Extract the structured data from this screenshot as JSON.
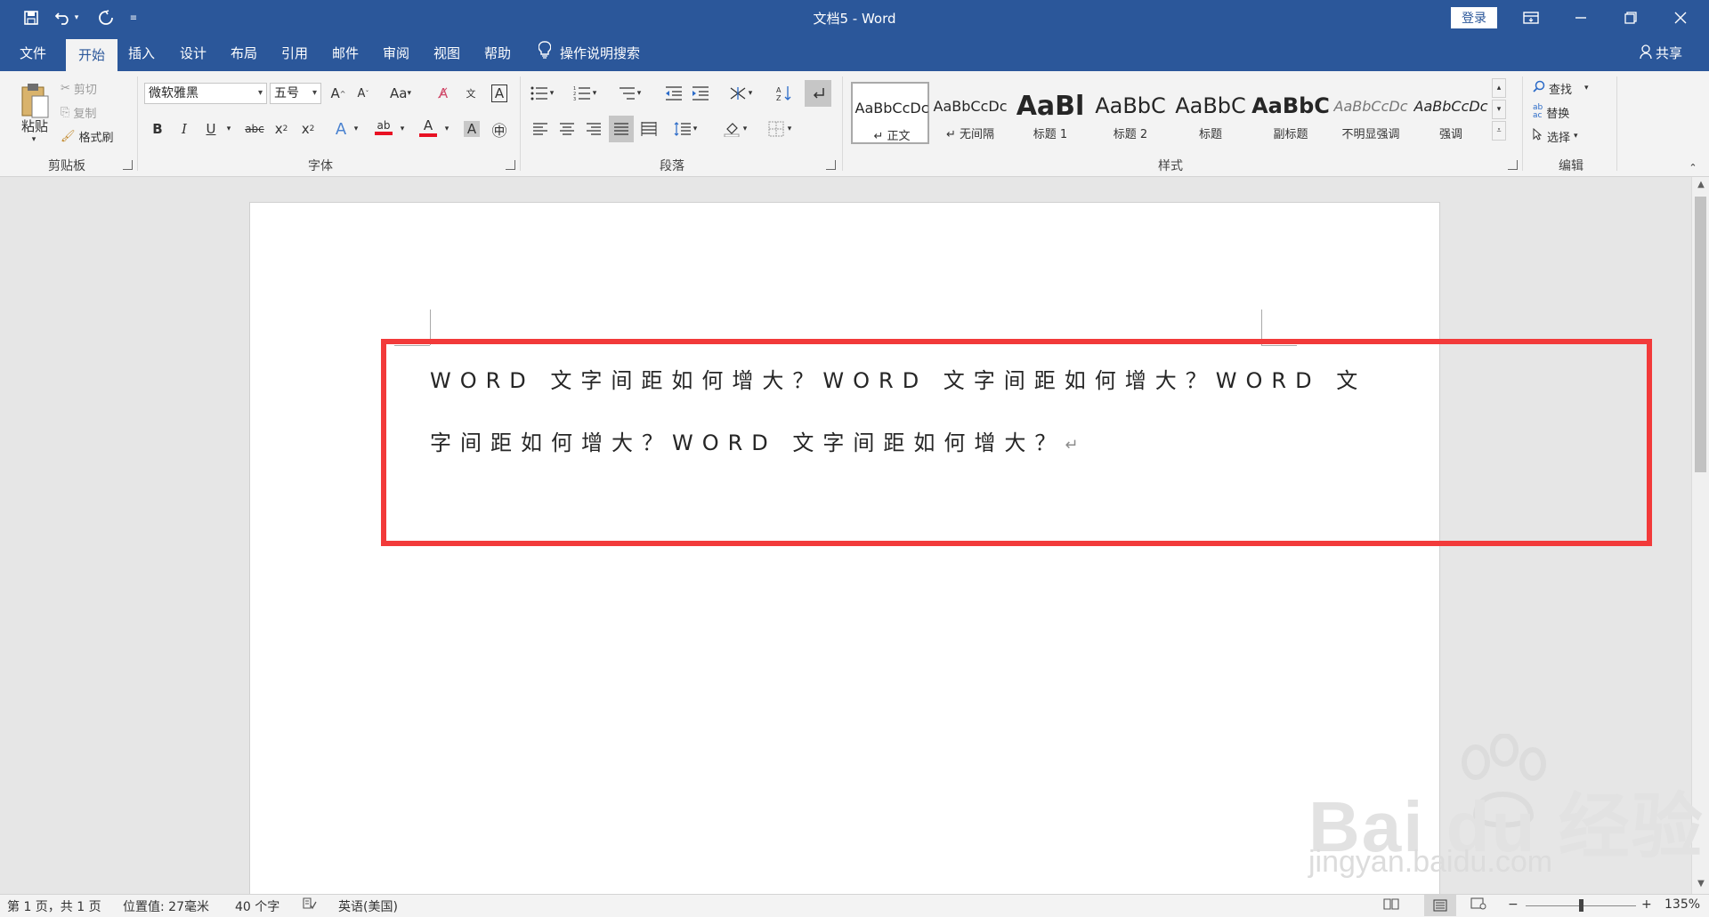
{
  "window": {
    "title": "文档5  -  Word",
    "login_label": "登录"
  },
  "tabs": [
    {
      "label": "文件"
    },
    {
      "label": "开始"
    },
    {
      "label": "插入"
    },
    {
      "label": "设计"
    },
    {
      "label": "布局"
    },
    {
      "label": "引用"
    },
    {
      "label": "邮件"
    },
    {
      "label": "审阅"
    },
    {
      "label": "视图"
    },
    {
      "label": "帮助"
    }
  ],
  "active_tab": "开始",
  "tell_me": "操作说明搜索",
  "share_label": "共享",
  "clipboard": {
    "paste": "粘贴",
    "cut": "剪切",
    "copy": "复制",
    "format_painter": "格式刷",
    "label": "剪贴板"
  },
  "font": {
    "name": "微软雅黑",
    "size": "五号",
    "label": "字体"
  },
  "paragraph": {
    "label": "段落"
  },
  "styles": {
    "label": "样式",
    "items": [
      {
        "sample": "AaBbCcDc",
        "name": "↵ 正文"
      },
      {
        "sample": "AaBbCcDc",
        "name": "↵ 无间隔"
      },
      {
        "sample": "AaBl",
        "name": "标题 1"
      },
      {
        "sample": "AaBbC",
        "name": "标题 2"
      },
      {
        "sample": "AaBbC",
        "name": "标题"
      },
      {
        "sample": "AaBbC",
        "name": "副标题"
      },
      {
        "sample": "AaBbCcDc",
        "name": "不明显强调"
      },
      {
        "sample": "AaBbCcDc",
        "name": "强调"
      }
    ]
  },
  "editing": {
    "find": "查找",
    "replace": "替换",
    "select": "选择",
    "label": "编辑"
  },
  "document": {
    "line1": "WORD 文字间距如何增大？WORD 文字间距如何增大？WORD 文",
    "line2": "字间距如何增大？WORD 文字间距如何增大？",
    "paragraph_mark": "↵"
  },
  "status": {
    "page": "第 1 页，共 1 页",
    "position": "位置值: 27毫米",
    "words": "40 个字",
    "language": "英语(美国)",
    "zoom": "135%"
  },
  "watermark": {
    "main": "Bai du 经验",
    "sub": "jingyan.baidu.com"
  },
  "colors": {
    "accent": "#2b579a",
    "highlight_box": "#f23a3a",
    "ribbon_bg": "#f3f3f3"
  }
}
